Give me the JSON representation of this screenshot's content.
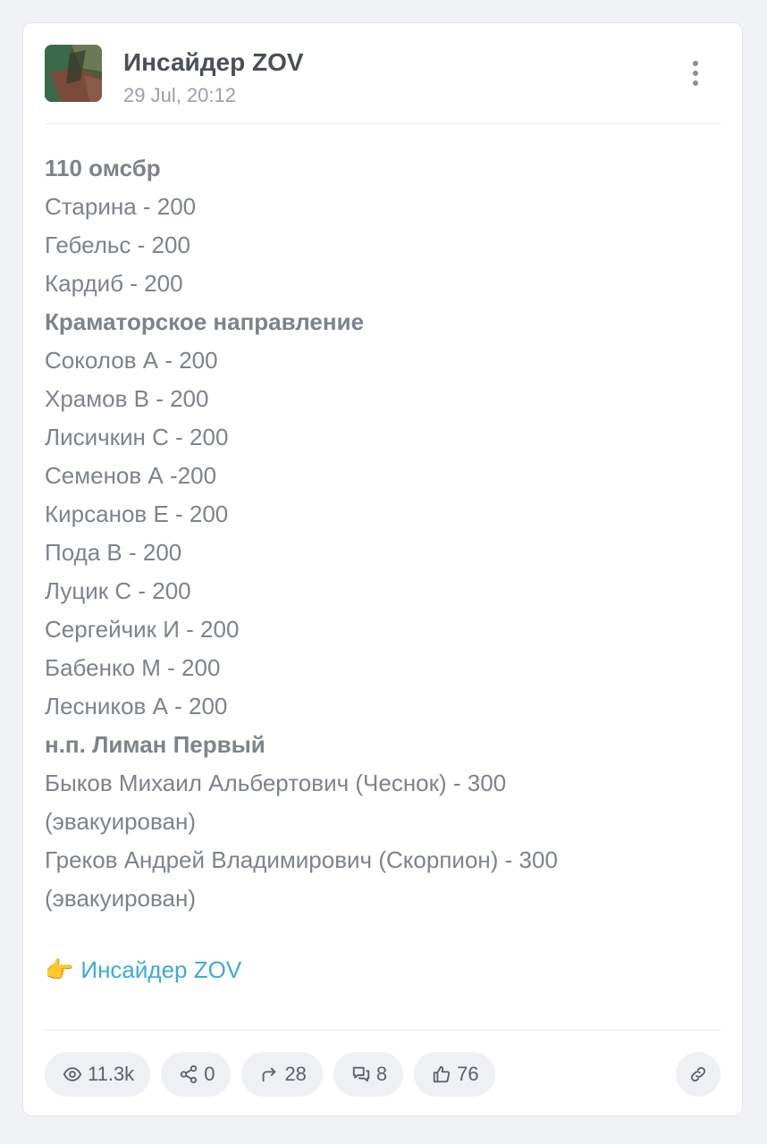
{
  "header": {
    "channel_name": "Инсайдер ZOV",
    "date": "29 Jul, 20:12"
  },
  "post": {
    "lines": [
      {
        "text": "110 омсбр",
        "bold": true
      },
      {
        "text": "Старина - 200",
        "bold": false
      },
      {
        "text": "Гебельс - 200",
        "bold": false
      },
      {
        "text": "Кардиб - 200",
        "bold": false
      },
      {
        "text": "Краматорское направление",
        "bold": true
      },
      {
        "text": "Соколов А - 200",
        "bold": false
      },
      {
        "text": "Храмов В - 200",
        "bold": false
      },
      {
        "text": "Лисичкин С - 200",
        "bold": false
      },
      {
        "text": "Семенов А -200",
        "bold": false
      },
      {
        "text": "Кирсанов Е - 200",
        "bold": false
      },
      {
        "text": "Пода В - 200",
        "bold": false
      },
      {
        "text": "Луцик С - 200",
        "bold": false
      },
      {
        "text": "Сергейчик И - 200",
        "bold": false
      },
      {
        "text": "Бабенко М - 200",
        "bold": false
      },
      {
        "text": "Лесников А - 200",
        "bold": false
      },
      {
        "text": "н.п. Лиман Первый",
        "bold": true
      },
      {
        "text": "Быков Михаил Альбертович (Чеснок) - 300 (эвакуирован)",
        "bold": false
      },
      {
        "text": "Греков Андрей Владимирович (Скорпион) - 300 (эвакуирован)",
        "bold": false
      }
    ],
    "link_emoji": "👉",
    "link_text": "Инсайдер ZOV"
  },
  "footer": {
    "views": "11.3k",
    "shares": "0",
    "forwards": "28",
    "comments": "8",
    "likes": "76"
  },
  "colors": {
    "link": "#3ea9dc",
    "text": "#7d838c",
    "title": "#4a4f57",
    "pill_bg": "#eef0f4"
  },
  "icons": [
    "more-vertical-icon",
    "eye-icon",
    "share-nodes-icon",
    "forward-arrow-icon",
    "comments-icon",
    "thumbs-up-icon",
    "link-icon"
  ]
}
